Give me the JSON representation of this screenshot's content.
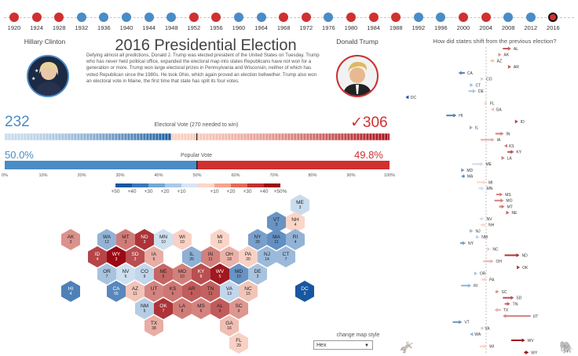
{
  "years": [
    "1920",
    "1924",
    "1928",
    "1932",
    "1936",
    "1940",
    "1944",
    "1948",
    "1952",
    "1956",
    "1960",
    "1964",
    "1968",
    "1972",
    "1976",
    "1980",
    "1984",
    "1988",
    "1992",
    "1996",
    "2000",
    "2004",
    "2008",
    "2012",
    "2016"
  ],
  "year_winner": [
    "r",
    "r",
    "r",
    "d",
    "d",
    "d",
    "d",
    "d",
    "r",
    "r",
    "d",
    "d",
    "r",
    "r",
    "d",
    "r",
    "r",
    "r",
    "d",
    "d",
    "r",
    "r",
    "d",
    "d",
    "r"
  ],
  "selected_year": "2016",
  "colors": {
    "dem": "#4a8cc6",
    "rep": "#d03030",
    "dem_dark": "#1e5fa0",
    "rep_dark": "#a8101a"
  },
  "dem_candidate": {
    "name": "Hillary Clinton"
  },
  "rep_candidate": {
    "name": "Donald Trump"
  },
  "title": "2016 Presidential Election",
  "description": "Defying almost all predictions, Donald J. Trump was elected president of the United States on Tuesday. Trump who has never held political office, expanded the electoral map into states Republicans have not won for a generation or more. Trump won large electoral prizes in Pennsylvania and Wisconsin, neither of which has voted Republican since the 1980s. He took Ohio, which again proved an election bellwether. Trump also won an electoral vote in Maine, the first time that state has split its four votes.",
  "electoral": {
    "dem": "232",
    "rep": "306",
    "rep_mark": "✓",
    "title": "Electoral Vote (270 needed to win)",
    "dem_share": 0.43
  },
  "popular": {
    "dem": "50.0%",
    "rep": "49.8%",
    "title": "Popular Vote",
    "dem_share": 0.5,
    "axis": [
      "0%",
      "10%",
      "20%",
      "30%",
      "40%",
      "50%",
      "60%",
      "70%",
      "80%",
      "90%",
      "100%"
    ]
  },
  "margin_legend": [
    "+50",
    "+40",
    "+30",
    "+20",
    "+10",
    "",
    "+10",
    "+20",
    "+30",
    "+40",
    "+50%"
  ],
  "shift_title": "How did states shift from the previous election?",
  "shifts": [
    {
      "s": "AL",
      "f": 0.18,
      "t": 0.27
    },
    {
      "s": "AK",
      "f": 0.14,
      "t": 0.15
    },
    {
      "s": "AZ",
      "f": 0.09,
      "t": 0.04
    },
    {
      "s": "AR",
      "f": 0.24,
      "t": 0.27
    },
    {
      "s": "CA",
      "f": -0.23,
      "t": -0.3
    },
    {
      "s": "CO",
      "f": -0.05,
      "t": -0.05
    },
    {
      "s": "CT",
      "f": -0.17,
      "t": -0.14
    },
    {
      "s": "DE",
      "f": -0.19,
      "t": -0.11
    },
    {
      "s": "DC",
      "f": -0.84,
      "t": -0.87
    },
    {
      "s": "FL",
      "f": -0.01,
      "t": 0.01
    },
    {
      "s": "GA",
      "f": 0.08,
      "t": 0.05
    },
    {
      "s": "HI",
      "f": -0.43,
      "t": -0.32
    },
    {
      "s": "ID",
      "f": 0.32,
      "t": 0.32
    },
    {
      "s": "IL",
      "f": -0.17,
      "t": -0.17
    },
    {
      "s": "IN",
      "f": 0.1,
      "t": 0.19
    },
    {
      "s": "IA",
      "f": -0.06,
      "t": 0.09
    },
    {
      "s": "KS",
      "f": 0.22,
      "t": 0.21
    },
    {
      "s": "KY",
      "f": 0.23,
      "t": 0.3
    },
    {
      "s": "LA",
      "f": 0.17,
      "t": 0.2
    },
    {
      "s": "ME",
      "f": -0.15,
      "t": -0.03
    },
    {
      "s": "MD",
      "f": -0.26,
      "t": -0.26
    },
    {
      "s": "MA",
      "f": -0.23,
      "t": -0.27
    },
    {
      "s": "MI",
      "f": -0.1,
      "t": 0.0
    },
    {
      "s": "MN",
      "f": -0.08,
      "t": -0.02
    },
    {
      "s": "MS",
      "f": 0.11,
      "t": 0.18
    },
    {
      "s": "MO",
      "f": 0.09,
      "t": 0.19
    },
    {
      "s": "MT",
      "f": 0.14,
      "t": 0.2
    },
    {
      "s": "NE",
      "f": 0.22,
      "t": 0.25
    },
    {
      "s": "NV",
      "f": -0.07,
      "t": -0.02
    },
    {
      "s": "NH",
      "f": -0.06,
      "t": 0.0
    },
    {
      "s": "NJ",
      "f": -0.18,
      "t": -0.14
    },
    {
      "s": "NM",
      "f": -0.1,
      "t": -0.08
    },
    {
      "s": "NY",
      "f": -0.28,
      "t": -0.22
    },
    {
      "s": "NC",
      "f": 0.02,
      "t": 0.04
    },
    {
      "s": "ND",
      "f": 0.2,
      "t": 0.36
    },
    {
      "s": "OH",
      "f": -0.03,
      "t": 0.08
    },
    {
      "s": "OK",
      "f": 0.34,
      "t": 0.36
    },
    {
      "s": "OR",
      "f": -0.12,
      "t": -0.11
    },
    {
      "s": "PA",
      "f": -0.05,
      "t": 0.01
    },
    {
      "s": "RI",
      "f": -0.27,
      "t": -0.16
    },
    {
      "s": "SC",
      "f": 0.1,
      "t": 0.14
    },
    {
      "s": "SD",
      "f": 0.18,
      "t": 0.3
    },
    {
      "s": "TN",
      "f": 0.2,
      "t": 0.26
    },
    {
      "s": "TX",
      "f": 0.16,
      "t": 0.09
    },
    {
      "s": "UT",
      "f": 0.48,
      "t": 0.18
    },
    {
      "s": "VT",
      "f": -0.36,
      "t": -0.26
    },
    {
      "s": "VA",
      "f": -0.04,
      "t": -0.05
    },
    {
      "s": "WA",
      "f": -0.15,
      "t": -0.16
    },
    {
      "s": "WV",
      "f": 0.27,
      "t": 0.42
    },
    {
      "s": "WI",
      "f": -0.07,
      "t": 0.01
    },
    {
      "s": "WY",
      "f": 0.41,
      "t": 0.46
    }
  ],
  "states": [
    {
      "a": "ME",
      "v": "3",
      "m": -0.03
    },
    {
      "a": "VT",
      "v": "3",
      "m": -0.26
    },
    {
      "a": "NH",
      "v": "4",
      "m": 0.0
    },
    {
      "a": "AK",
      "v": "3",
      "m": 0.15
    },
    {
      "a": "WA",
      "v": "12",
      "m": -0.16
    },
    {
      "a": "MT",
      "v": "3",
      "m": 0.2
    },
    {
      "a": "ND",
      "v": "3",
      "m": 0.36
    },
    {
      "a": "MN",
      "v": "10",
      "m": -0.02
    },
    {
      "a": "WI",
      "v": "10",
      "m": 0.01
    },
    {
      "a": "MI",
      "v": "16",
      "m": 0.003
    },
    {
      "a": "NY",
      "v": "29",
      "m": -0.22
    },
    {
      "a": "MA",
      "v": "11",
      "m": -0.27
    },
    {
      "a": "RI",
      "v": "4",
      "m": -0.16
    },
    {
      "a": "ID",
      "v": "4",
      "m": 0.32
    },
    {
      "a": "WY",
      "v": "3",
      "m": 0.46
    },
    {
      "a": "SD",
      "v": "3",
      "m": 0.3
    },
    {
      "a": "IA",
      "v": "6",
      "m": 0.09
    },
    {
      "a": "IL",
      "v": "20",
      "m": -0.17
    },
    {
      "a": "IN",
      "v": "11",
      "m": 0.19
    },
    {
      "a": "OH",
      "v": "18",
      "m": 0.08
    },
    {
      "a": "PA",
      "v": "20",
      "m": 0.01
    },
    {
      "a": "NJ",
      "v": "14",
      "m": -0.14
    },
    {
      "a": "CT",
      "v": "7",
      "m": -0.14
    },
    {
      "a": "OR",
      "v": "7",
      "m": -0.11
    },
    {
      "a": "NV",
      "v": "6",
      "m": -0.02
    },
    {
      "a": "CO",
      "v": "9",
      "m": -0.05
    },
    {
      "a": "NE",
      "v": "5",
      "m": 0.25
    },
    {
      "a": "MO",
      "v": "10",
      "m": 0.19
    },
    {
      "a": "KY",
      "v": "8",
      "m": 0.3
    },
    {
      "a": "WV",
      "v": "5",
      "m": 0.42
    },
    {
      "a": "MD",
      "v": "10",
      "m": -0.26
    },
    {
      "a": "DE",
      "v": "3",
      "m": -0.11
    },
    {
      "a": "HI",
      "v": "4",
      "m": -0.32
    },
    {
      "a": "CA",
      "v": "55",
      "m": -0.3
    },
    {
      "a": "AZ",
      "v": "11",
      "m": 0.04
    },
    {
      "a": "UT",
      "v": "6",
      "m": 0.18
    },
    {
      "a": "KS",
      "v": "6",
      "m": 0.21
    },
    {
      "a": "AR",
      "v": "6",
      "m": 0.27
    },
    {
      "a": "TN",
      "v": "11",
      "m": 0.26
    },
    {
      "a": "VA",
      "v": "13",
      "m": -0.05
    },
    {
      "a": "NC",
      "v": "15",
      "m": 0.04
    },
    {
      "a": "DC",
      "v": "3",
      "m": -0.87
    },
    {
      "a": "NM",
      "v": "5",
      "m": -0.08
    },
    {
      "a": "OK",
      "v": "7",
      "m": 0.36
    },
    {
      "a": "LA",
      "v": "8",
      "m": 0.2
    },
    {
      "a": "MS",
      "v": "6",
      "m": 0.18
    },
    {
      "a": "AL",
      "v": "9",
      "m": 0.27
    },
    {
      "a": "SC",
      "v": "9",
      "m": 0.14
    },
    {
      "a": "TX",
      "v": "38",
      "m": 0.09
    },
    {
      "a": "GA",
      "v": "16",
      "m": 0.05
    },
    {
      "a": "FL",
      "v": "29",
      "m": 0.01
    }
  ],
  "map_style": {
    "label": "change map style",
    "value": "Hex"
  },
  "icons": {
    "dem_mascot": "donkey-icon",
    "rep_mascot": "elephant-icon"
  }
}
